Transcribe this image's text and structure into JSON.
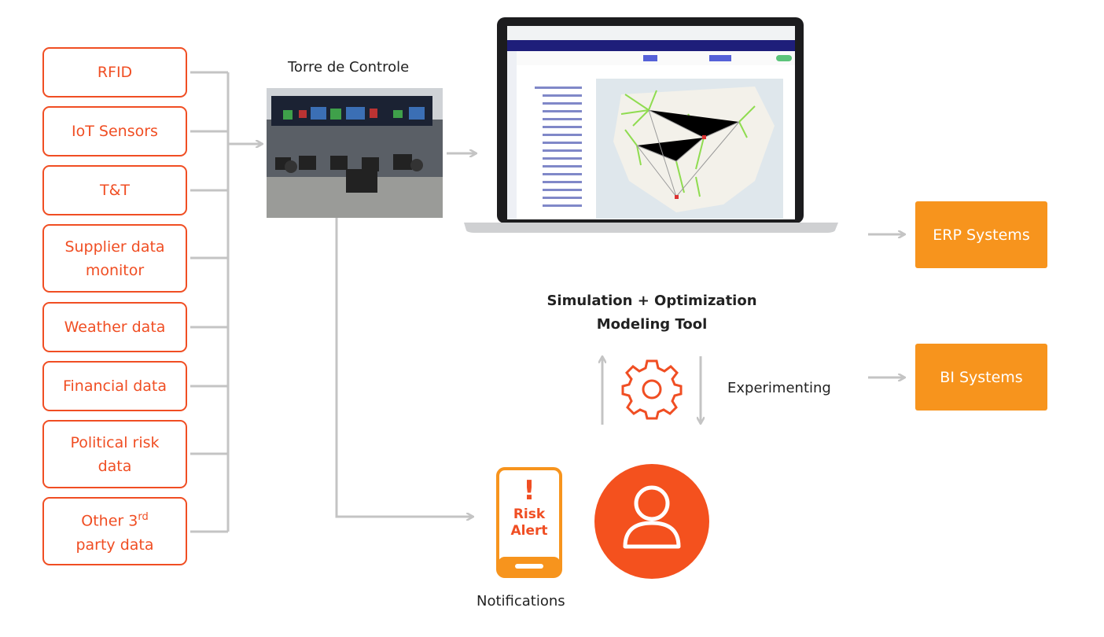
{
  "sources": [
    "RFID",
    "IoT Sensors",
    "T&T",
    "Supplier data monitor",
    "Weather data",
    "Financial data",
    "Political risk data"
  ],
  "other_source": {
    "text": "Other 3",
    "sup": "rd",
    "line2": "party data"
  },
  "control_tower": {
    "label": "Torre de Controle"
  },
  "tool": {
    "line1": "Simulation + Optimization",
    "line2": "Modeling Tool"
  },
  "experimenting": "Experimenting",
  "outputs": [
    "ERP Systems",
    "BI Systems"
  ],
  "alert": {
    "mark": "!",
    "line1": "Risk",
    "line2": "Alert"
  },
  "notifications": "Notifications",
  "colors": {
    "accent": "#f04e23",
    "output": "#f7941d",
    "connector": "#c4c4c4"
  }
}
